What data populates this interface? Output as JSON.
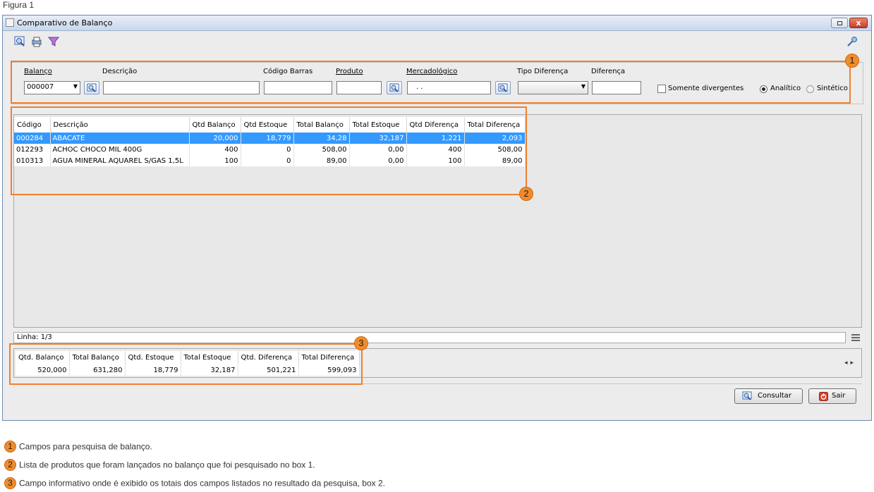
{
  "figure_label": "Figura 1",
  "window": {
    "title": "Comparativo de Balanço",
    "close_label": "x"
  },
  "filters": {
    "balanco_label": "Balanço",
    "balanco_value": "000007",
    "descricao_label": "Descrição",
    "descricao_value": "",
    "codigo_barras_label": "Código Barras",
    "codigo_barras_value": "",
    "produto_label": "Produto",
    "produto_value": "",
    "mercadologico_label": "Mercadológico",
    "mercadologico_value": ".  .",
    "tipo_diferenca_label": "Tipo Diferença",
    "tipo_diferenca_value": "",
    "diferenca_label": "Diferença",
    "diferenca_value": "",
    "somente_divergentes_label": "Somente divergentes",
    "somente_divergentes_checked": false,
    "analitico_label": "Analítico",
    "sintetico_label": "Sintético",
    "selected_mode": "Analítico"
  },
  "grid": {
    "columns": [
      "Código",
      "Descrição",
      "Qtd Balanço",
      "Qtd Estoque",
      "Total Balanço",
      "Total Estoque",
      "Qtd Diferença",
      "Total Diferença"
    ],
    "rows": [
      [
        "000284",
        "ABACATE",
        "20,000",
        "18,779",
        "34,28",
        "32,187",
        "1,221",
        "2,093"
      ],
      [
        "012293",
        "ACHOC CHOCO MIL 400G",
        "400",
        "0",
        "508,00",
        "0,00",
        "400",
        "508,00"
      ],
      [
        "010313",
        "AGUA MINERAL AQUAREL S/GAS 1,5L",
        "100",
        "0",
        "89,00",
        "0,00",
        "100",
        "89,00"
      ]
    ],
    "selected_row": 0,
    "status": "Linha: 1/3"
  },
  "totals": {
    "columns": [
      "Qtd. Balanço",
      "Total Balanço",
      "Qtd. Estoque",
      "Total Estoque",
      "Qtd. Diferença",
      "Total Diferença"
    ],
    "values": [
      "520,000",
      "631,280",
      "18,779",
      "32,187",
      "501,221",
      "599,093"
    ]
  },
  "buttons": {
    "consultar": "Consultar",
    "sair": "Sair"
  },
  "annotations": [
    "1",
    "2",
    "3"
  ],
  "legend": [
    {
      "num": "1",
      "text": "Campos para pesquisa de balanço."
    },
    {
      "num": "2",
      "text": "Lista de produtos que foram lançados no balanço que foi pesquisado no box 1."
    },
    {
      "num": "3",
      "text": "Campo informativo onde é exibido os totais dos campos listados no resultado da pesquisa, box 2."
    }
  ],
  "colors": {
    "accent_orange": "#ee8033",
    "selection_blue": "#3399ff",
    "title_blue": "#c9d7ec"
  }
}
